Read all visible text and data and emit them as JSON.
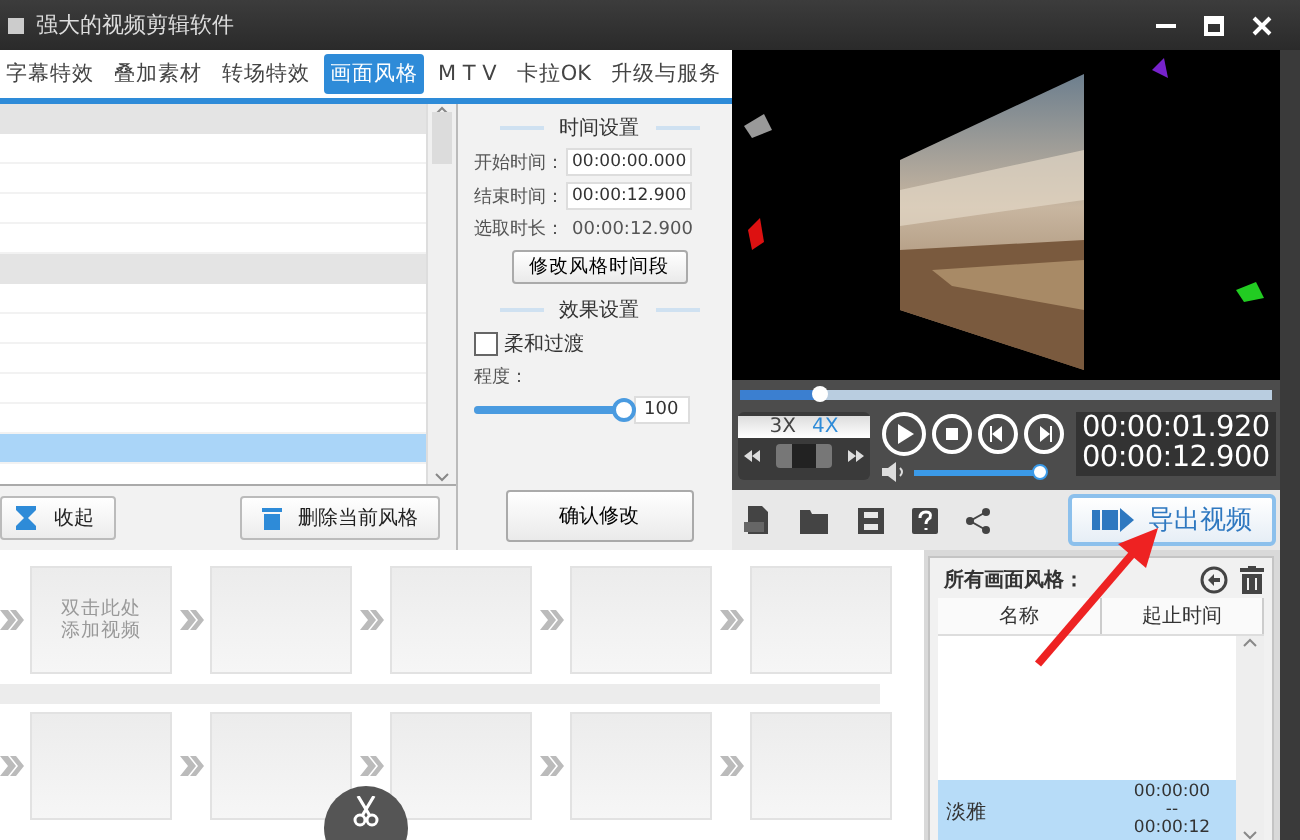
{
  "window": {
    "title": "强大的视频剪辑软件"
  },
  "tabs": [
    {
      "label": "字幕特效",
      "selected": false
    },
    {
      "label": "叠加素材",
      "selected": false
    },
    {
      "label": "转场特效",
      "selected": false
    },
    {
      "label": "画面风格",
      "selected": true
    },
    {
      "label": "M T V",
      "selected": false
    },
    {
      "label": "卡拉OK",
      "selected": false
    },
    {
      "label": "升级与服务",
      "selected": false
    }
  ],
  "style_list": {
    "rows": [
      {
        "kind": "group",
        "selected": false
      },
      {
        "kind": "item",
        "selected": false
      },
      {
        "kind": "item",
        "selected": false
      },
      {
        "kind": "item",
        "selected": false
      },
      {
        "kind": "item",
        "selected": false
      },
      {
        "kind": "group",
        "selected": false
      },
      {
        "kind": "item",
        "selected": false
      },
      {
        "kind": "item",
        "selected": false
      },
      {
        "kind": "item",
        "selected": false
      },
      {
        "kind": "item",
        "selected": false
      },
      {
        "kind": "item",
        "selected": false
      },
      {
        "kind": "item",
        "selected": true
      }
    ]
  },
  "list_buttons": [
    {
      "kind": "collapse",
      "label": "收起"
    },
    {
      "kind": "delete",
      "label": "删除当前风格"
    }
  ],
  "time_settings": {
    "title": "时间设置",
    "start_label": "开始时间：",
    "start_value": "00:00:00.000",
    "end_label": "结束时间：",
    "end_value": "00:00:12.900",
    "duration_label": "选取时长：",
    "duration_value": "00:00:12.900",
    "button": "修改风格时间段"
  },
  "effect_settings": {
    "title": "效果设置",
    "smooth": {
      "label": "柔和过渡",
      "checked": false
    },
    "degree": {
      "label": "程度：",
      "level": 1,
      "value": "100"
    }
  },
  "confirm_button": "确认修改",
  "player": {
    "progress": {
      "level": 0.15
    },
    "speeds": [
      {
        "label": "3X",
        "selected": false
      },
      {
        "label": "4X",
        "selected": true
      }
    ],
    "volume": {
      "level": 0.95
    },
    "current_time": "00:00:01.920",
    "total_time": "00:00:12.900"
  },
  "export_button": "导出视频",
  "timeline": {
    "tracks": [
      {
        "slots": [
          {
            "kind": "add",
            "text": "双击此处添加视频"
          },
          {
            "kind": "empty"
          },
          {
            "kind": "empty"
          },
          {
            "kind": "empty"
          },
          {
            "kind": "empty"
          }
        ]
      },
      {
        "slots": [
          {
            "kind": "empty"
          },
          {
            "kind": "empty"
          },
          {
            "kind": "empty"
          },
          {
            "kind": "empty"
          },
          {
            "kind": "empty"
          }
        ]
      }
    ]
  },
  "applied_styles": {
    "title": "所有画面风格：",
    "columns": [
      "名称",
      "起止时间"
    ],
    "rows": [
      {
        "name": "淡雅",
        "start": "00:00:00",
        "separator": "--",
        "end": "00:00:12",
        "selected": true
      }
    ]
  }
}
